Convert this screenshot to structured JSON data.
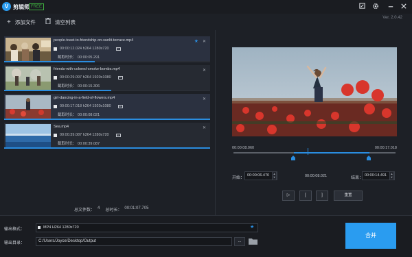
{
  "app": {
    "logo": "V",
    "title": "剪辑师",
    "badge": "FREE",
    "version": "Ver. 2.0.42"
  },
  "titlebar_icons": [
    "feedback-icon",
    "gear-icon",
    "minimize-icon",
    "close-icon"
  ],
  "toolbar": {
    "add_label": "添加文件",
    "clear_label": "清空列表"
  },
  "files": [
    {
      "name": "people-toast-to-friendship-on-sunlit-terrace.mp4",
      "info": "00:00:12.024 h264 1280x720",
      "duration_label": "截取时长：",
      "duration": "00:00:05.291",
      "selected": true,
      "progress": 0.44,
      "starred": true
    },
    {
      "name": "friends-with-colored-smoke-bombs.mp4",
      "info": "00:00:29.097 h264 1920x1080",
      "duration_label": "截取时长：",
      "duration": "00:00:15.306",
      "selected": false,
      "progress": 0.52,
      "starred": false
    },
    {
      "name": "girl-dancing-in-a-field-of-flowers.mp4",
      "info": "00:00:17.018 h264 1920x1080",
      "duration_label": "截取时长：",
      "duration": "00:00:08.021",
      "selected": true,
      "progress": 1.0,
      "starred": false
    },
    {
      "name": "Sea.mp4",
      "info": "00:00:39.087 h264 1280x720",
      "duration_label": "截取时长：",
      "duration": "00:00:39.087",
      "selected": false,
      "progress": 1.0,
      "starred": false
    }
  ],
  "summary": {
    "count_label": "总文件数：",
    "count": "4",
    "total_label": "总时长：",
    "total": "00:01:07.705"
  },
  "player": {
    "time_start": "00:00:08.060",
    "time_end": "00:00:17.018",
    "start_label": "开始：",
    "start_value": "00:00:06.470",
    "duration_value": "00:00:08.021",
    "end_label": "结束：",
    "end_value": "00:00:14.491",
    "controls": {
      "play": "▷",
      "mark_in": "[",
      "mark_out": "]",
      "reset": "重置"
    }
  },
  "output": {
    "format_label": "输出格式：",
    "format_value": "MP4 H264 1280x720",
    "dir_label": "输出目录：",
    "dir_value": "C:/Users/Joyce/Desktop/Output",
    "browse_label": "...",
    "merge_label": "合并"
  },
  "colors": {
    "accent": "#2a9cf0",
    "free": "#3fae3f",
    "background": "#1d2026"
  }
}
